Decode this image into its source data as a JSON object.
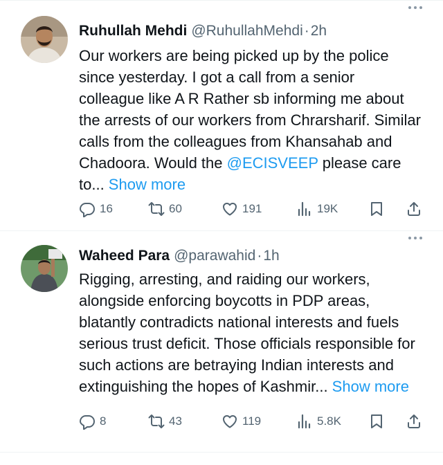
{
  "tweets": [
    {
      "name": "Ruhullah Mehdi",
      "handle": "@RuhullahMehdi",
      "separator": "·",
      "time": "2h",
      "text_parts": [
        "Our workers are being picked up by the police since yesterday. I got a call from a senior colleague like A R Rather sb informing me about the arrests of our workers from Chrarsharif. Similar calls from the colleagues from Khansahab and Chadoora. Would the ",
        "@ECISVEEP",
        " please care to... ",
        "Show more"
      ],
      "replies": "16",
      "retweets": "60",
      "likes": "191",
      "views": "19K"
    },
    {
      "name": "Waheed Para",
      "handle": "@parawahid",
      "separator": "·",
      "time": "1h",
      "text_parts": [
        "Rigging, arresting, and raiding our  workers, alongside enforcing boycotts in PDP areas, blatantly contradicts national interests and fuels serious trust deficit. Those officials responsible for such actions are betraying Indian interests and extinguishing the hopes of Kashmir... ",
        "Show more"
      ],
      "replies": "8",
      "retweets": "43",
      "likes": "119",
      "views": "5.8K"
    }
  ],
  "icons": {
    "reply": "reply-icon",
    "retweet": "retweet-icon",
    "like": "heart-icon",
    "views": "views-icon",
    "bookmark": "bookmark-icon",
    "share": "share-icon",
    "more": "more-icon"
  },
  "colors": {
    "link": "#1d9bf0",
    "secondary": "#536471",
    "text": "#0f1419"
  }
}
